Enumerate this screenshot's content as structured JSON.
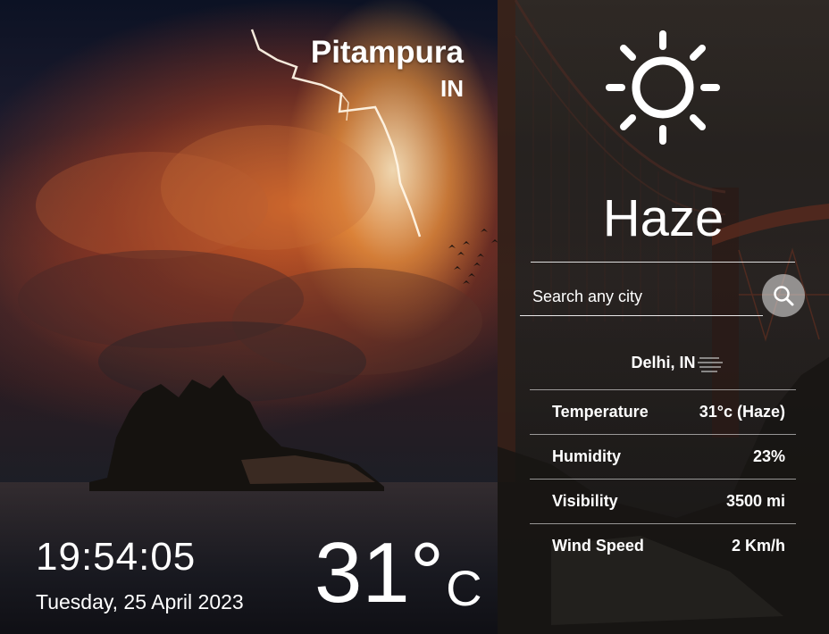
{
  "location": {
    "city": "Pitampura",
    "country": "IN"
  },
  "time": "19:54:05",
  "date": "Tuesday, 25 April 2023",
  "current": {
    "temp_value": "31°",
    "temp_unit": "C"
  },
  "weather": {
    "icon": "sun-icon",
    "condition": "Haze"
  },
  "search": {
    "placeholder": "Search any city",
    "value": ""
  },
  "result": {
    "location": "Delhi, IN",
    "icon": "haze-icon"
  },
  "details": [
    {
      "label": "Temperature",
      "value": "31°c (Haze)"
    },
    {
      "label": "Humidity",
      "value": "23%"
    },
    {
      "label": "Visibility",
      "value": "3500 mi"
    },
    {
      "label": "Wind Speed",
      "value": "2 Km/h"
    }
  ]
}
